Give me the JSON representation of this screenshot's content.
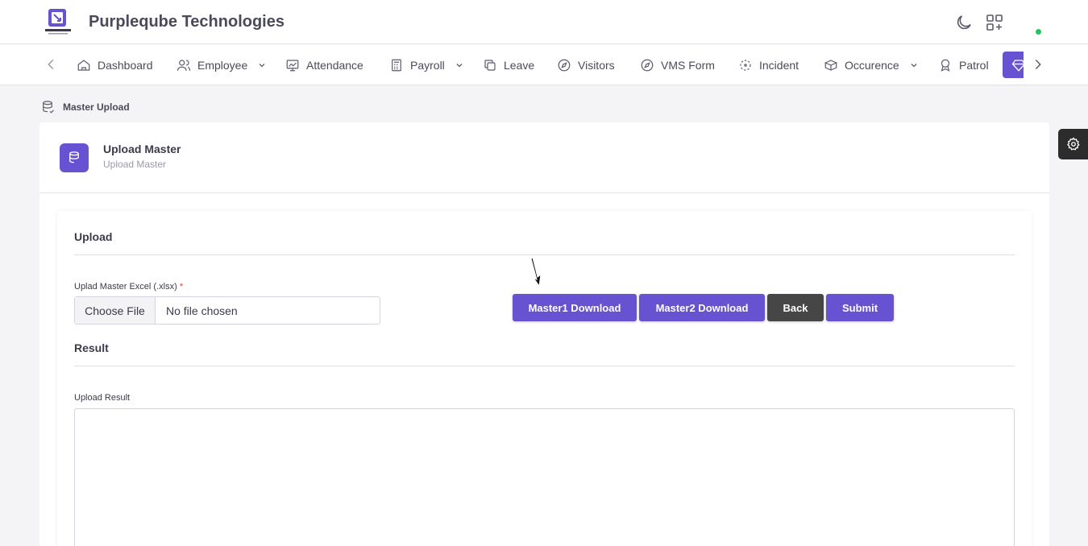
{
  "app": {
    "brand": "Purpleqube Technologies",
    "colors": {
      "accent": "#6752d2",
      "dark_button": "#464646",
      "status": "#22c55e"
    }
  },
  "header": {
    "icons": [
      "moon-icon",
      "apps-add-icon"
    ]
  },
  "nav": {
    "items": [
      {
        "label": "Dashboard",
        "icon": "home-icon"
      },
      {
        "label": "Employee",
        "icon": "users-icon",
        "dropdown": true
      },
      {
        "label": "Attendance",
        "icon": "chart-icon"
      },
      {
        "label": "Payroll",
        "icon": "calculator-icon",
        "dropdown": true
      },
      {
        "label": "Leave",
        "icon": "copy-icon"
      },
      {
        "label": "Visitors",
        "icon": "compass-icon"
      },
      {
        "label": "VMS Form",
        "icon": "compass-icon"
      },
      {
        "label": "Incident",
        "icon": "focus-icon"
      },
      {
        "label": "Occurence",
        "icon": "box-icon",
        "dropdown": true
      },
      {
        "label": "Patrol",
        "icon": "award-icon"
      }
    ],
    "active_icon": "diamond-icon"
  },
  "breadcrumb": {
    "label": "Master Upload"
  },
  "card": {
    "title": "Upload Master",
    "subtitle": "Upload Master"
  },
  "upload_section": {
    "title": "Upload",
    "file_label": "Uplad Master Excel (.xlsx)",
    "required_mark": "*",
    "choose_label": "Choose File",
    "file_status": "No file chosen",
    "buttons": {
      "master1": "Master1 Download",
      "master2": "Master2 Download",
      "back": "Back",
      "submit": "Submit"
    }
  },
  "result_section": {
    "title": "Result",
    "result_label": "Upload Result",
    "result_value": ""
  }
}
